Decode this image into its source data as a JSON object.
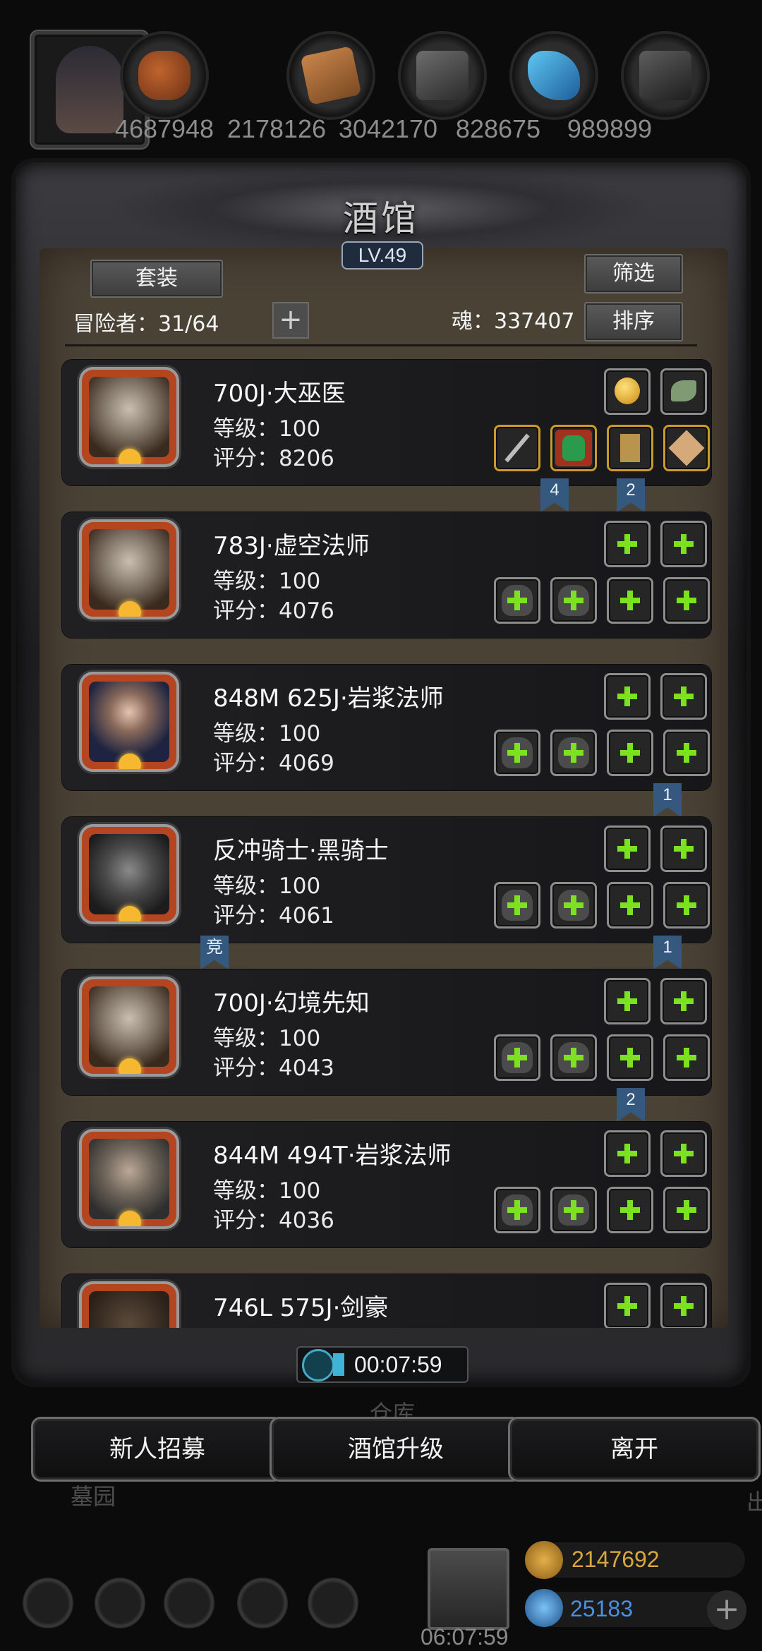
{
  "resources": [
    {
      "icon": "meat-icon",
      "value": "4687948"
    },
    {
      "icon": "wood-icon",
      "value": "2178126"
    },
    {
      "icon": "iron-ingot-icon",
      "value": "3042170"
    },
    {
      "icon": "crystal-icon",
      "value": "828675"
    },
    {
      "icon": "stone-icon",
      "value": "989899"
    }
  ],
  "panel": {
    "title": "酒馆",
    "level": "LV.49",
    "set_button": "套装",
    "filter_button": "筛选",
    "sort_button": "排序",
    "adventurers": "冒险者：31/64",
    "soul": "魂：337407"
  },
  "heroes": [
    {
      "name": "700J·大巫医",
      "level": "等级：100",
      "score": "评分：8206"
    },
    {
      "name": "783J·虚空法师",
      "level": "等级：100",
      "score": "评分：4076"
    },
    {
      "name": "848M 625J·岩浆法师",
      "level": "等级：100",
      "score": "评分：4069"
    },
    {
      "name": "反冲骑士·黑骑士",
      "level": "等级：100",
      "score": "评分：4061"
    },
    {
      "name": "700J·幻境先知",
      "level": "等级：100",
      "score": "评分：4043"
    },
    {
      "name": "844M 494T·岩浆法师",
      "level": "等级：100",
      "score": "评分：4036"
    },
    {
      "name": "746L 575J·剑豪",
      "level": "",
      "score": ""
    }
  ],
  "ribbons": {
    "r1": "4",
    "r2": "2",
    "r3": "1",
    "r4": "竞",
    "r5": "1",
    "r6": "2"
  },
  "timer": "00:07:59",
  "buttons": {
    "recruit": "新人招募",
    "upgrade": "酒馆升级",
    "leave": "离开"
  },
  "background_labels": {
    "warehouse": "仓库",
    "cemetery": "墓园",
    "exit": "出"
  },
  "bottom_hud": {
    "gift_timer": "06:07:59",
    "gold": "2147692",
    "gems": "25183"
  },
  "colors": {
    "accent_green": "#7ce21f",
    "panel_brown": "#4b4236",
    "gold_text": "#d9a640",
    "gem_text": "#4a8fe0"
  }
}
